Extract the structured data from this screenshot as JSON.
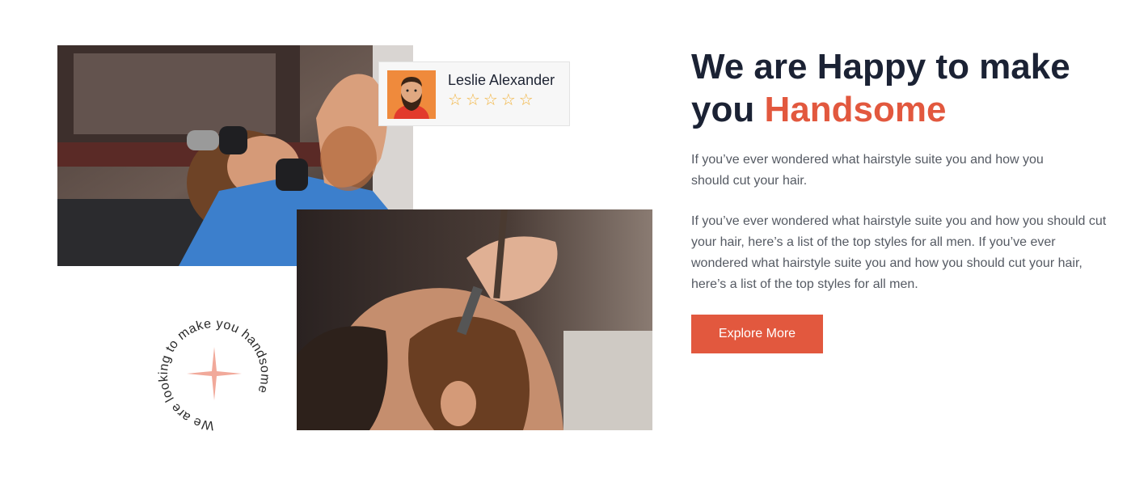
{
  "hero": {
    "headline_line1": "We are Happy to make",
    "headline_prefix": "you",
    "headline_accent": "Handsome",
    "accent_color": "#e2583e",
    "paragraph_1": "If you’ve ever wondered what hairstyle suite you and how you should cut your hair.",
    "paragraph_2": "If you’ve ever wondered what hairstyle suite you and how you should cut your hair, here’s a list of the top styles for all men. If you’ve ever wondered what hairstyle suite you and how you should cut your hair, here’s a list of the top styles for all men.",
    "cta_label": "Explore More"
  },
  "review": {
    "name": "Leslie Alexander",
    "stars": [
      "☆",
      "☆",
      "☆",
      "☆",
      "☆"
    ],
    "star_color": "#f2b33d"
  },
  "badge": {
    "circular_text": "We are looking to make you handsome",
    "icon": "sparkle-icon"
  },
  "images": {
    "top": "barber-trimming-beard-photo",
    "bottom": "straight-razor-shave-photo"
  }
}
